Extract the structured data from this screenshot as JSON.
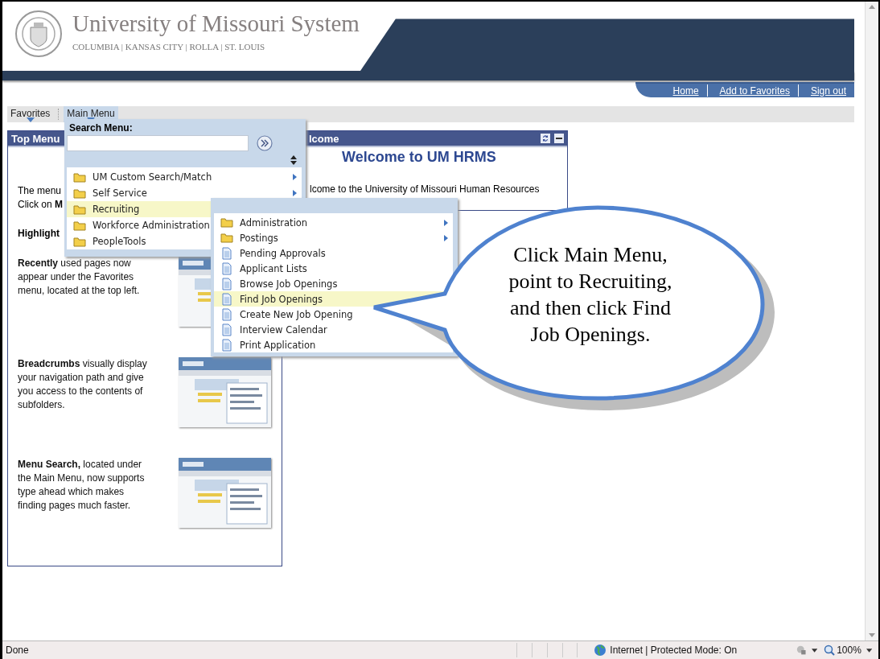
{
  "header": {
    "title": "University of Missouri System",
    "campuses": "COLUMBIA | KANSAS CITY | ROLLA | ST. LOUIS"
  },
  "header_links": [
    "Home",
    "Add to Favorites",
    "Sign out"
  ],
  "nav": [
    {
      "label": "Favorites",
      "selected": false
    },
    {
      "label": "Main Menu",
      "selected": true
    }
  ],
  "top_menu": {
    "title": "Top Menu",
    "lines": [
      "The menu",
      "Click on **M**"
    ],
    "highlights": "Highlight",
    "features": [
      {
        "text": "**Recently** used pages now appear under the Favorites menu, located at the top left.",
        "kind": "picture"
      },
      {
        "text": "**Breadcrumbs** visually display your navigation path and give you access to the contents of subfolders.",
        "kind": "picture"
      },
      {
        "text": "**Menu Search,** located under the Main Menu, now supports type ahead which makes finding pages much faster.",
        "kind": "picture"
      }
    ]
  },
  "welcome": {
    "title": "lcome",
    "heading": "Welcome to UM HRMS",
    "text": "lcome to the University of Missouri Human Resources"
  },
  "main_menu": {
    "search_label": "Search Menu:",
    "items": [
      {
        "label": "UM Custom Search/Match",
        "selected": false
      },
      {
        "label": "Self Service",
        "selected": false
      },
      {
        "label": "Recruiting",
        "selected": true
      },
      {
        "label": "Workforce Administration",
        "selected": false
      },
      {
        "label": "PeopleTools",
        "selected": false
      }
    ]
  },
  "submenu": {
    "items": [
      {
        "label": "Administration",
        "kind": "folder",
        "submenu": true,
        "selected": false
      },
      {
        "label": "Postings",
        "kind": "folder",
        "submenu": true,
        "selected": false
      },
      {
        "label": "Pending Approvals",
        "kind": "page",
        "submenu": false,
        "selected": false
      },
      {
        "label": "Applicant Lists",
        "kind": "page",
        "submenu": false,
        "selected": false
      },
      {
        "label": "Browse Job Openings",
        "kind": "page",
        "submenu": false,
        "selected": false
      },
      {
        "label": "Find Job Openings",
        "kind": "page",
        "submenu": false,
        "selected": true
      },
      {
        "label": "Create New Job Opening",
        "kind": "page",
        "submenu": false,
        "selected": false
      },
      {
        "label": "Interview Calendar",
        "kind": "page",
        "submenu": false,
        "selected": false
      },
      {
        "label": "Print Application",
        "kind": "page",
        "submenu": false,
        "selected": false
      }
    ]
  },
  "callout": "Click Main Menu, point to Recruiting, and then click Find Job Openings.",
  "status_bar": {
    "status": "Done",
    "zone": "Internet | Protected Mode: On",
    "zoom": "100%"
  }
}
